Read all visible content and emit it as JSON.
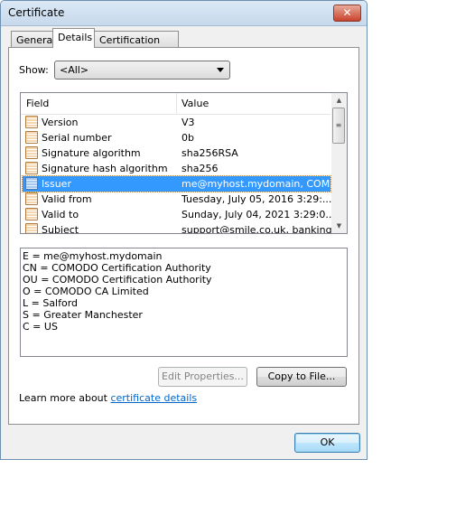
{
  "window": {
    "title": "Certificate",
    "close_icon": "close-icon"
  },
  "tabs": [
    {
      "label": "General"
    },
    {
      "label": "Details",
      "active": true
    },
    {
      "label": "Certification Path"
    }
  ],
  "show": {
    "label": "Show:",
    "value": "<All>"
  },
  "list": {
    "headers": {
      "field": "Field",
      "value": "Value"
    },
    "rows": [
      {
        "field": "Version",
        "value": "V3"
      },
      {
        "field": "Serial number",
        "value": "0b"
      },
      {
        "field": "Signature algorithm",
        "value": "sha256RSA"
      },
      {
        "field": "Signature hash algorithm",
        "value": "sha256"
      },
      {
        "field": "Issuer",
        "value": "me@myhost.mydomain, COM...",
        "selected": true
      },
      {
        "field": "Valid from",
        "value": "Tuesday, July 05, 2016 3:29:..."
      },
      {
        "field": "Valid to",
        "value": "Sunday, July 04, 2021 3:29:0..."
      },
      {
        "field": "Subject",
        "value": "support@smile.co.uk, banking..."
      }
    ]
  },
  "detail_lines": [
    "E = me@myhost.mydomain",
    "CN = COMODO Certification Authority",
    "OU = COMODO Certification Authority",
    "O = COMODO CA Limited",
    "L = Salford",
    "S = Greater Manchester",
    "C = US"
  ],
  "buttons": {
    "edit": "Edit Properties...",
    "copy": "Copy to File...",
    "ok": "OK"
  },
  "learn": {
    "text": "Learn more about ",
    "link": "certificate details"
  },
  "colors": {
    "selection": "#3399ff",
    "link": "#0066cc"
  }
}
